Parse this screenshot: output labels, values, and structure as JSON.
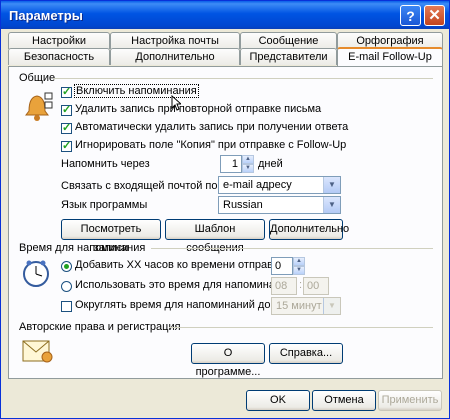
{
  "window": {
    "title": "Параметры",
    "help_glyph": "?",
    "close_glyph": "✕"
  },
  "tabs_row1": [
    "Настройки",
    "Настройка почты",
    "Сообщение",
    "Орфография"
  ],
  "tabs_row2": [
    "Безопасность",
    "Дополнительно",
    "Представители",
    "E-mail Follow-Up"
  ],
  "general": {
    "heading": "Общие",
    "enable_reminders": "Включить напоминания",
    "delete_on_resend": "Удалить запись при повторной отправке письма",
    "auto_delete": "Автоматически удалить запись при получении ответа",
    "ignore_cc": "Игнорировать поле \"Копия\" при отправке с Follow-Up",
    "remind_after_label": "Напомнить через",
    "remind_after_value": "1",
    "days_label": "дней",
    "link_inbox_label": "Связать с входящей почтой по",
    "link_inbox_value": "e-mail адресу",
    "language_label": "Язык программы",
    "language_value": "Russian",
    "view_records": "Посмотреть записи",
    "message_template": "Шаблон сообщения",
    "more": "Дополнительно"
  },
  "reminder_time": {
    "heading": "Время для напоминания",
    "add_hours_label": "Добавить XX часов ко времени отправки",
    "add_hours_value": "0",
    "use_time_label": "Использовать это время для напоминаний:",
    "hour_value": "08",
    "colon": ":",
    "minute_value": "00",
    "round_label": "Округлять время для напоминаний до",
    "round_value": "15 минут"
  },
  "copyright": {
    "heading": "Авторские права и регистрация",
    "about": "О программе...",
    "help": "Справка..."
  },
  "footer": {
    "ok": "OK",
    "cancel": "Отмена",
    "apply": "Применить"
  },
  "colors": {
    "titlebar": "#0054e3",
    "active_tab_accent": "#e68b2c",
    "check": "#21a121",
    "dialog_bg": "#ece9d8"
  }
}
